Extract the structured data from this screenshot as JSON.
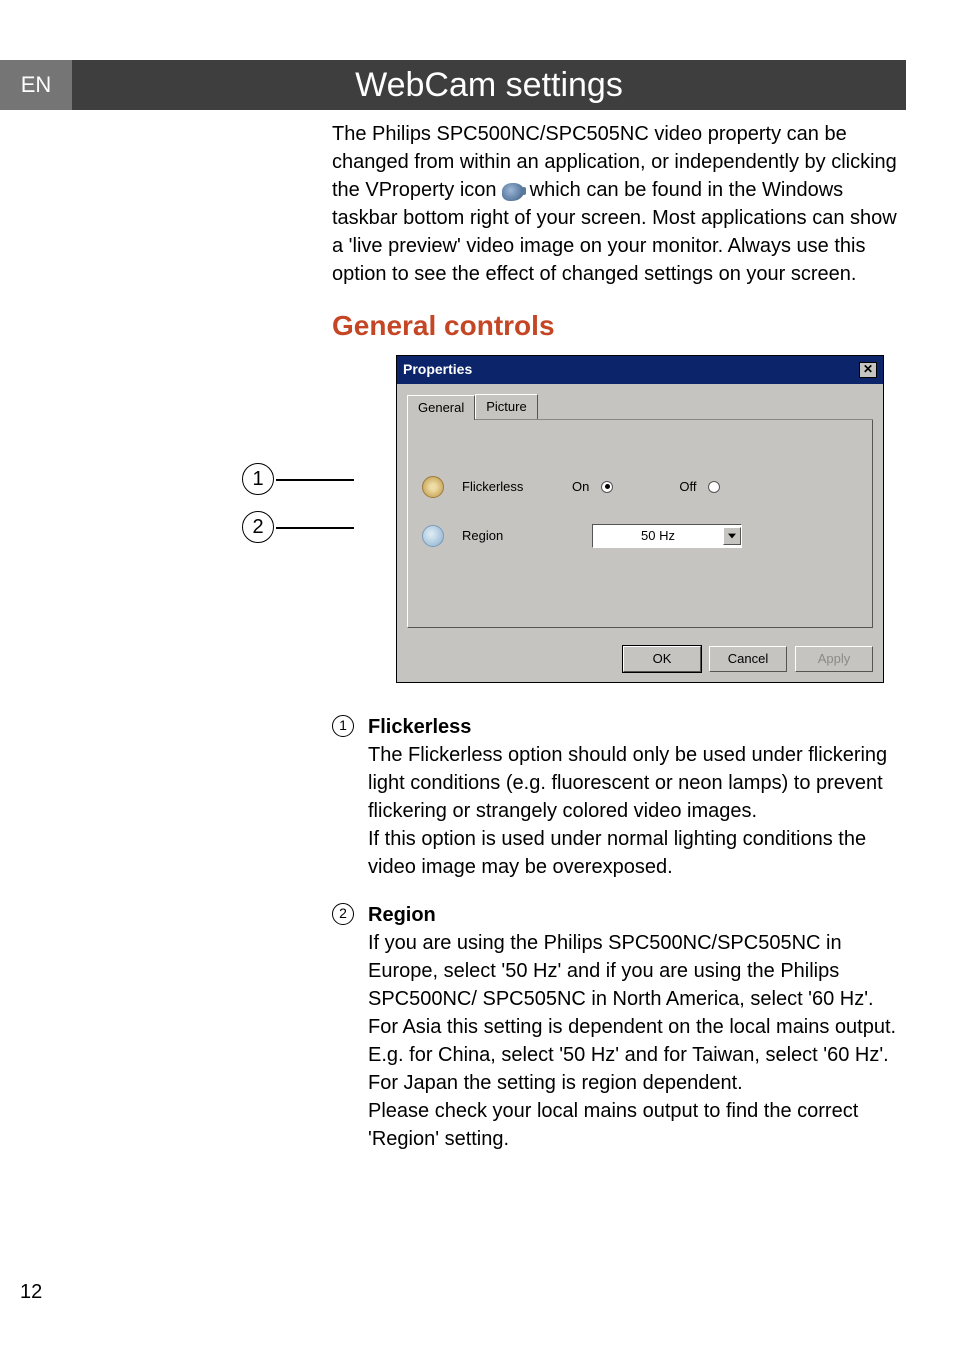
{
  "lang": "EN",
  "title": "WebCam settings",
  "intro": "The Philips SPC500NC/SPC505NC video property can be changed from within an application, or independently by clicking the VProperty icon which can be found in the Windows taskbar bottom right of your screen. Most applications can show a 'live preview' video image on your monitor. Always use this option to see the effect of changed settings on your screen.",
  "intro_pre": "The Philips SPC500NC/SPC505NC video property can be changed from within an application, or independently by clicking the VProperty icon ",
  "intro_post": " which can be found in the Windows taskbar bottom right of your screen. Most applications can show a 'live preview' video image on your monitor. Always use this option to see the effect of changed settings on your screen.",
  "section": "General controls",
  "dialog": {
    "title": "Properties",
    "tabs": [
      "General",
      "Picture"
    ],
    "active_tab": 0,
    "rows": [
      {
        "label": "Flickerless",
        "on": "On",
        "off": "Off",
        "selected": "On"
      },
      {
        "label": "Region",
        "value": "50 Hz"
      }
    ],
    "buttons": {
      "ok": "OK",
      "cancel": "Cancel",
      "apply": "Apply"
    }
  },
  "desc": [
    {
      "num": "1",
      "heading": "Flickerless",
      "body1": "The Flickerless option should only be used under flickering light conditions (e.g. fluorescent or neon lamps) to prevent flickering or strangely colored video images.",
      "body2": "If this option is used under normal lighting conditions the video image may be overexposed."
    },
    {
      "num": "2",
      "heading": "Region",
      "body1": "If you are using the Philips SPC500NC/SPC505NC in Europe, select '50 Hz' and if you are using the Philips SPC500NC/ SPC505NC in North America, select '60 Hz'. For Asia this setting is dependent on the local mains output. E.g. for China, select '50 Hz' and for Taiwan, select '60 Hz'. For Japan the setting is region dependent.",
      "body2": "Please check your local mains output to find the correct 'Region' setting."
    }
  ],
  "page_number": "12"
}
